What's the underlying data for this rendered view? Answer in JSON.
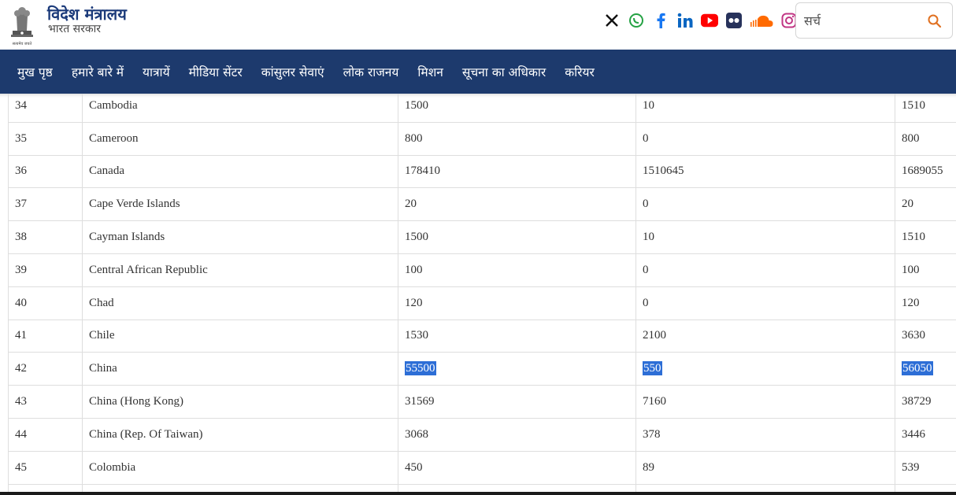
{
  "header": {
    "title": "विदेश मंत्रालय",
    "subtitle": "भारत सरकार",
    "emblem_motto": "सत्यमेव जयते",
    "social_icons": [
      "x-icon",
      "whatsapp-icon",
      "facebook-icon",
      "linkedin-icon",
      "youtube-icon",
      "flickr-icon",
      "soundcloud-icon",
      "instagram-icon"
    ],
    "search_placeholder": "सर्च"
  },
  "nav": {
    "items": [
      "मुख पृष्ठ",
      "हमारे बारे में",
      "यात्रायें",
      "मीडिया सेंटर",
      "कांसुलर सेवाएं",
      "लोक राजनय",
      "मिशन",
      "सूचना का अधिकार",
      "करियर"
    ]
  },
  "colors": {
    "nav_bg": "#1d3a6d",
    "title": "#1b3a7a",
    "highlight": "#2d6ed6"
  },
  "table": {
    "rows": [
      [
        "34",
        "Cambodia",
        "1500",
        "10",
        "1510"
      ],
      [
        "35",
        "Cameroon",
        "800",
        "0",
        "800"
      ],
      [
        "36",
        "Canada",
        "178410",
        "1510645",
        "1689055"
      ],
      [
        "37",
        "Cape Verde Islands",
        "20",
        "0",
        "20"
      ],
      [
        "38",
        "Cayman Islands",
        "1500",
        "10",
        "1510"
      ],
      [
        "39",
        "Central African Republic",
        "100",
        "0",
        "100"
      ],
      [
        "40",
        "Chad",
        "120",
        "0",
        "120"
      ],
      [
        "41",
        "Chile",
        "1530",
        "2100",
        "3630"
      ],
      [
        "42",
        "China",
        "55500",
        "550",
        "56050"
      ],
      [
        "43",
        "China (Hong Kong)",
        "31569",
        "7160",
        "38729"
      ],
      [
        "44",
        "China (Rep. Of Taiwan)",
        "3068",
        "378",
        "3446"
      ],
      [
        "45",
        "Colombia",
        "450",
        "89",
        "539"
      ],
      [
        "",
        "",
        "",
        "",
        ""
      ]
    ],
    "highlighted_row": "42"
  }
}
